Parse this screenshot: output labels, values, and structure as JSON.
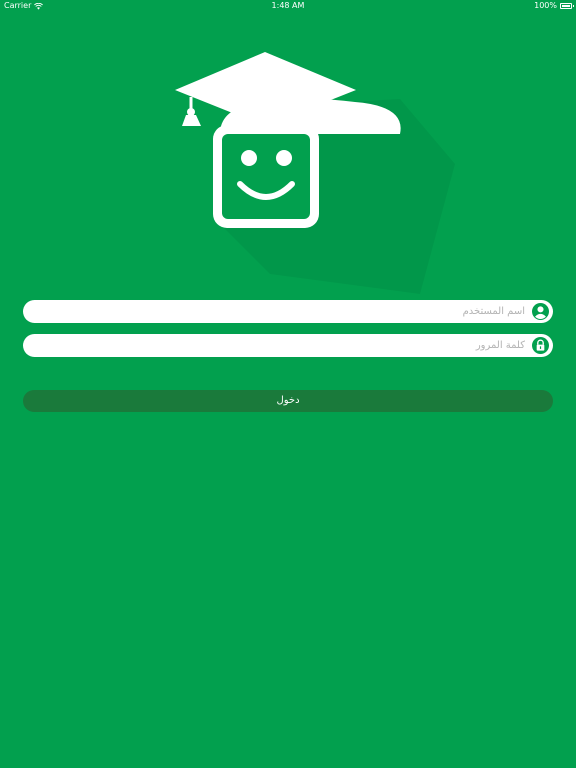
{
  "status_bar": {
    "carrier": "Carrier",
    "time": "1:48 AM",
    "battery": "100%",
    "wifi_icon": "wifi-icon",
    "battery_icon": "battery-icon"
  },
  "logo": {
    "icon": "graduation-smiley-logo"
  },
  "login_form": {
    "username": {
      "value": "",
      "placeholder": "اسم المستخدم",
      "icon": "user-icon"
    },
    "password": {
      "value": "",
      "placeholder": "كلمة المرور",
      "icon": "lock-icon"
    },
    "submit_label": "دخول"
  },
  "colors": {
    "background": "#02a04e",
    "button": "#1a7a3b",
    "field": "#ffffff",
    "icon": "#02a04e"
  }
}
